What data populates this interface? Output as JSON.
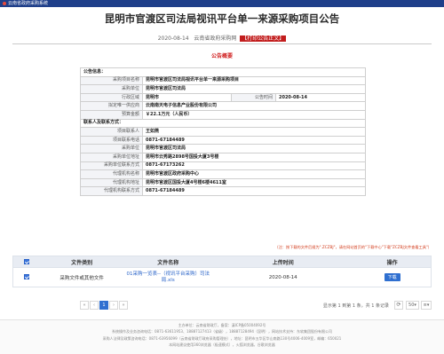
{
  "window": {
    "title": "云南省政府采购系统"
  },
  "header": {
    "title": "昆明市官渡区司法局视讯平台单一来源采购项目公告",
    "date": "2020-08-14",
    "source": "云南省政府采购网",
    "print_link": "【打印公告正文】"
  },
  "notice_label": "公告概要",
  "info": {
    "section_general": "公告信息：",
    "project_name_label": "采购项目名称",
    "project_name": "昆明市官渡区司法局视讯平台单一来源采购项目",
    "buyer_label": "采购单位",
    "buyer": "昆明市官渡区司法局",
    "region_label": "行政区域",
    "region": "昆明市",
    "publish_time_label": "公告时间",
    "publish_time": "2020-08-14",
    "supplier_label": "拟定唯一供应商",
    "supplier": "云南南天电子信息产业股份有限公司",
    "budget_label": "预算金额",
    "budget": "￥22.1万元（人民币）",
    "section_contact": "联系人及联系方式：",
    "contact_label": "项目联系人",
    "contact": "王如燕",
    "contact_phone_label": "项目联系电话",
    "contact_phone": "0871-67184489",
    "buyer2_label": "采购单位",
    "buyer2": "昆明市官渡区司法局",
    "buyer_addr_label": "采购单位地址",
    "buyer_addr": "昆明市云秀路2898号国投大厦3号楼",
    "buyer_phone_label": "采购单位联系方式",
    "buyer_phone": "0871-67173262",
    "agency_label": "代理机构名称",
    "agency": "昆明市官渡区政府采购中心",
    "agency_addr_label": "代理机构地址",
    "agency_addr": "昆明市官渡区国投大厦4号楼6楼4611室",
    "agency_phone_label": "代理机构联系方式",
    "agency_phone": "0871-67184489"
  },
  "tip": "（注：按下载的文件后缀为\".ZCZBJ\"，请在网站首页的\"下载中心\"下载\"ZCZBJ文件查看工具\"）",
  "attachments": {
    "col_type": "文件类别",
    "col_name": "文件名称",
    "col_time": "上传时间",
    "col_action": "操作",
    "rows": [
      {
        "type": "采购文件或其他文件",
        "name": "01采购一览表--（视讯平台采购）司法局.xls",
        "time": "2020-08-14",
        "action": "下载"
      }
    ]
  },
  "pager": {
    "first": "«",
    "prev": "‹",
    "page": "1",
    "next": "›",
    "last": "»",
    "info": "显示第 1 到第 1 条，共 1 条记录",
    "refresh": "⟳",
    "page_size": "50",
    "columns": "≡"
  },
  "footer": {
    "line1": "主办单位：云南省财政厅，备案：滇ICP备05004092号",
    "line2": "系统操作及业务咨询电话：0871-63611953、18887127413（省级），18887128494（昆明），网站技术支持：东软集团股份有限公司",
    "line3": "采购人法律及政策咨询电话：0871-63956099（云南省财政厅政府采购管理处），地址：昆明市五华区华山南路130号4006-4009室，邮编：650021",
    "line4": "本网站建议使用360浏览器（极速模式），火狐浏览器，谷歌浏览器"
  }
}
